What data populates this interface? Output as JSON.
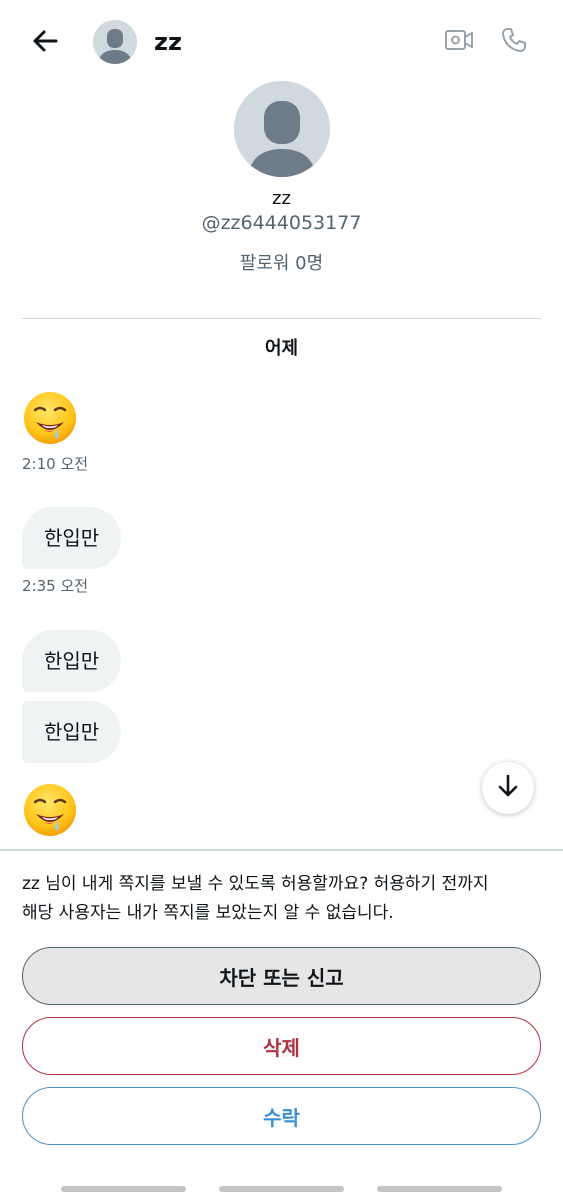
{
  "header": {
    "back_icon": "arrow-left-icon",
    "name": "zz",
    "video_icon": "video-camera-icon",
    "call_icon": "phone-icon"
  },
  "profile": {
    "name": "zz",
    "handle": "@zz6444053177",
    "followers": "팔로워 0명"
  },
  "conversation": {
    "date_separator": "어제",
    "messages": [
      {
        "type": "emoji",
        "icon": "drooling-face-emoji"
      },
      {
        "type": "timestamp",
        "text": "2:10 오전"
      },
      {
        "type": "text",
        "text": "한입만"
      },
      {
        "type": "timestamp",
        "text": "2:35 오전"
      },
      {
        "type": "text",
        "text": "한입만"
      },
      {
        "type": "text",
        "text": "한입만"
      },
      {
        "type": "emoji",
        "icon": "drooling-face-emoji"
      }
    ]
  },
  "scroll_down_icon": "arrow-down-icon",
  "request": {
    "line1": "zz 님이 내게 쪽지를 보낼 수 있도록 허용할까요? 허용하기 전까지",
    "line2": "해당 사용자는 내가 쪽지를 보았는지 알 수 없습니다.",
    "block_label": "차단 또는 신고",
    "delete_label": "삭제",
    "accept_label": "수락"
  },
  "colors": {
    "text_primary": "#0f1419",
    "text_secondary": "#536471",
    "bubble_bg": "#eff3f4",
    "danger": "#b0313f",
    "accent": "#3a8fd6",
    "avatar_bg": "#cfd9de"
  }
}
